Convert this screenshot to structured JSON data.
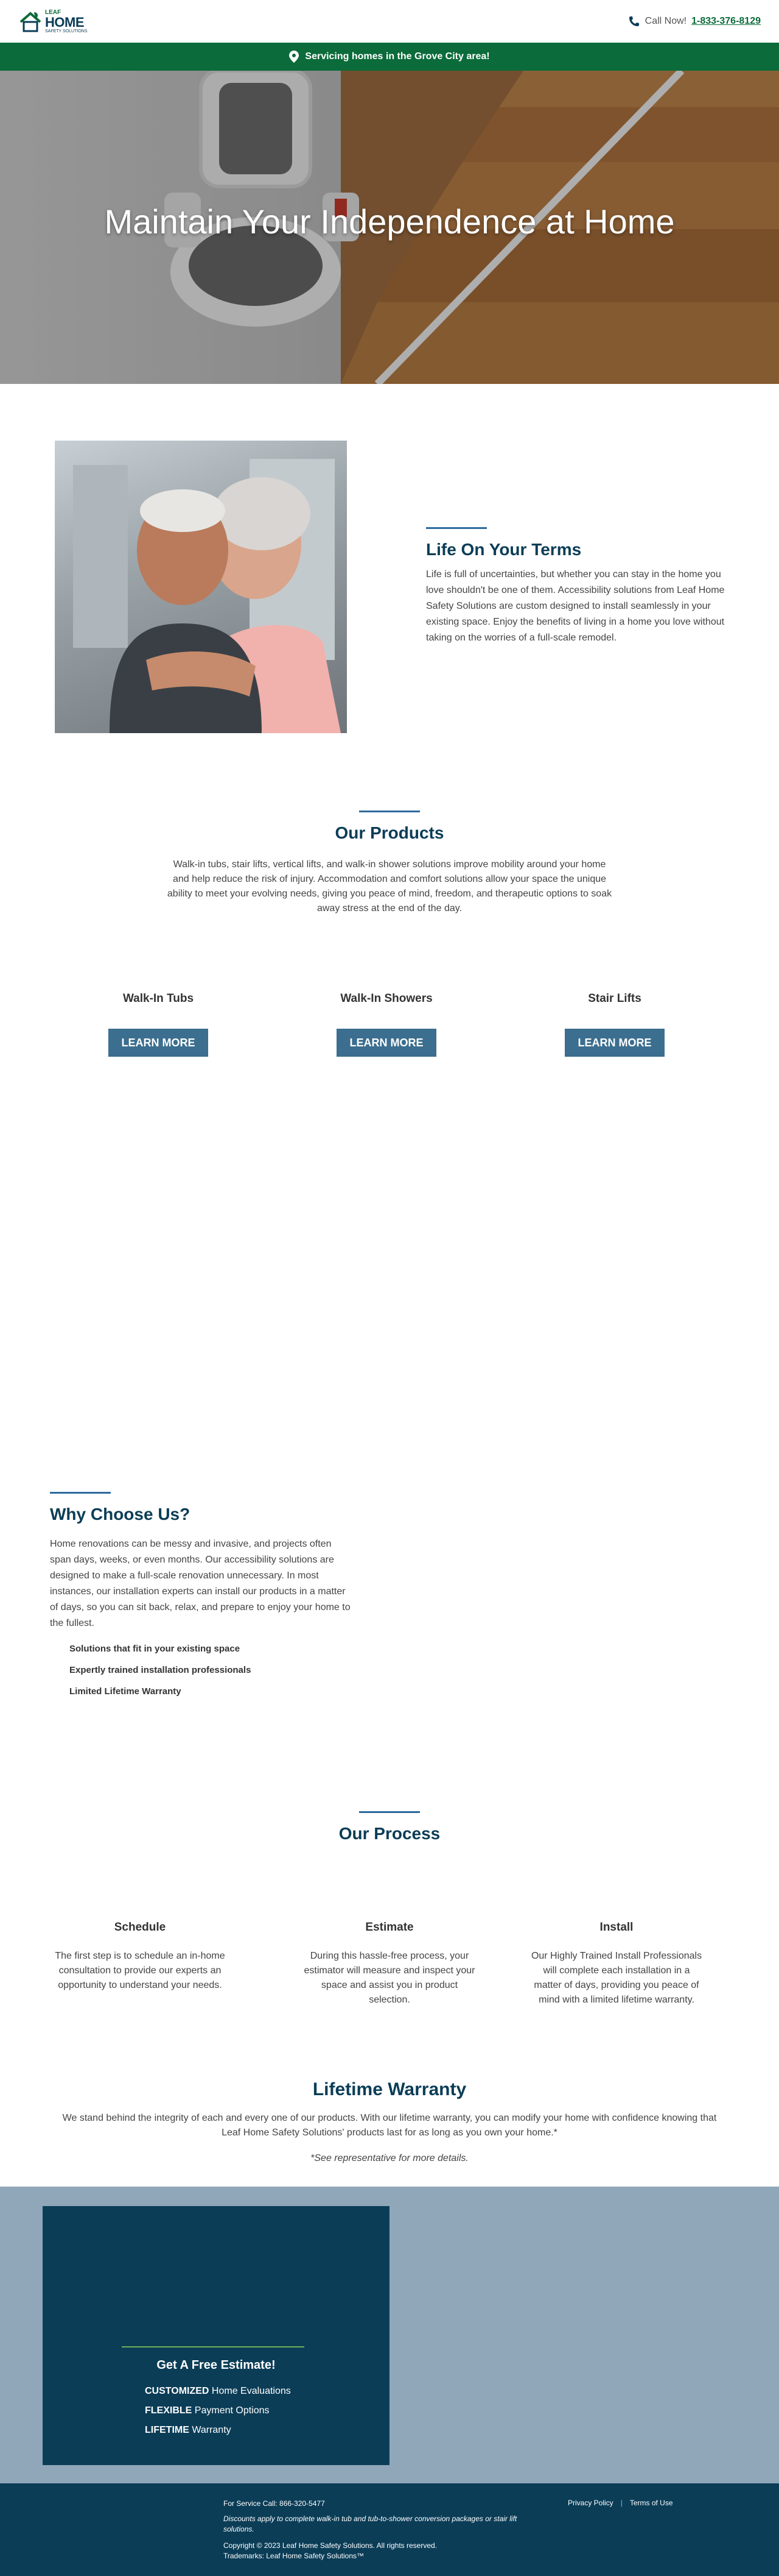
{
  "header": {
    "logo_leaf": "LEAF",
    "logo_home": "HOME",
    "logo_sub": "SAFETY SOLUTIONS",
    "call_label": "Call Now!",
    "phone": "1-833-376-8129"
  },
  "banner": {
    "text": "Servicing homes in the Grove City area!"
  },
  "hero": {
    "title": "Maintain Your Independence at Home"
  },
  "life": {
    "heading": "Life On Your Terms",
    "body": "Life is full of uncertainties, but whether you can stay in the home you love shouldn't be one of them. Accessibility solutions from Leaf Home Safety Solutions are custom designed to install seamlessly in your existing space. Enjoy the benefits of living in a home you love without taking on the worries of a full-scale remodel."
  },
  "products": {
    "heading": "Our Products",
    "body": "Walk-in tubs, stair lifts, vertical lifts, and walk-in shower solutions improve mobility around your home and help reduce the risk of injury. Accommodation and comfort solutions allow your space the unique ability to meet your evolving needs, giving you peace of mind, freedom, and therapeutic options to soak away stress at the end of the day.",
    "items": [
      {
        "title": "Walk-In Tubs",
        "button": "LEARN MORE"
      },
      {
        "title": "Walk-In Showers",
        "button": "LEARN MORE"
      },
      {
        "title": "Stair Lifts",
        "button": "LEARN MORE"
      }
    ]
  },
  "why": {
    "heading": "Why Choose Us?",
    "body": "Home renovations can be messy and invasive, and projects often span days, weeks, or even months. Our accessibility solutions are designed to make a full-scale renovation unnecessary. In most instances, our installation experts can install our products in a matter of days, so you can sit back, relax, and prepare to enjoy your home to the fullest.",
    "points": [
      "Solutions that fit in your existing space",
      "Expertly trained installation professionals",
      "Limited Lifetime Warranty"
    ]
  },
  "process": {
    "heading": "Our Process",
    "steps": [
      {
        "title": "Schedule",
        "body": "The first step is to schedule an in-home consultation to provide our experts an opportunity to understand your needs."
      },
      {
        "title": "Estimate",
        "body": "During this hassle-free process, your estimator will measure and inspect your space and assist you in product selection."
      },
      {
        "title": "Install",
        "body": "Our Highly Trained Install Professionals will complete each installation in a matter of days, providing you peace of mind with a limited lifetime warranty."
      }
    ]
  },
  "warranty": {
    "heading": "Lifetime Warranty",
    "body": "We stand behind the integrity of each and every one of our products. With our lifetime warranty, you can modify your home with confidence knowing that Leaf Home Safety Solutions' products last for as long as you own your home.*",
    "fine": "*See representative for more details."
  },
  "estimate": {
    "heading": "Get A Free Estimate!",
    "items": [
      {
        "bold": "CUSTOMIZED",
        "rest": " Home Evaluations"
      },
      {
        "bold": "FLEXIBLE",
        "rest": " Payment Options"
      },
      {
        "bold": "LIFETIME",
        "rest": " Warranty"
      }
    ]
  },
  "footer": {
    "service": "For Service Call: 866-320-5477",
    "discount": "Discounts apply to complete walk-in tub and tub-to-shower conversion packages or stair lift solutions.",
    "copyright": "Copyright © 2023 Leaf Home Safety Solutions. All rights reserved.",
    "trademark": "Trademarks: Leaf Home Safety Solutions™",
    "privacy": "Privacy Policy",
    "terms": "Terms of Use",
    "separator": "|"
  },
  "colors": {
    "brand_green": "#0b6b3a",
    "brand_navy": "#0b3d57",
    "button_blue": "#3b6e8f",
    "estimate_bg": "#8fa7b9"
  }
}
